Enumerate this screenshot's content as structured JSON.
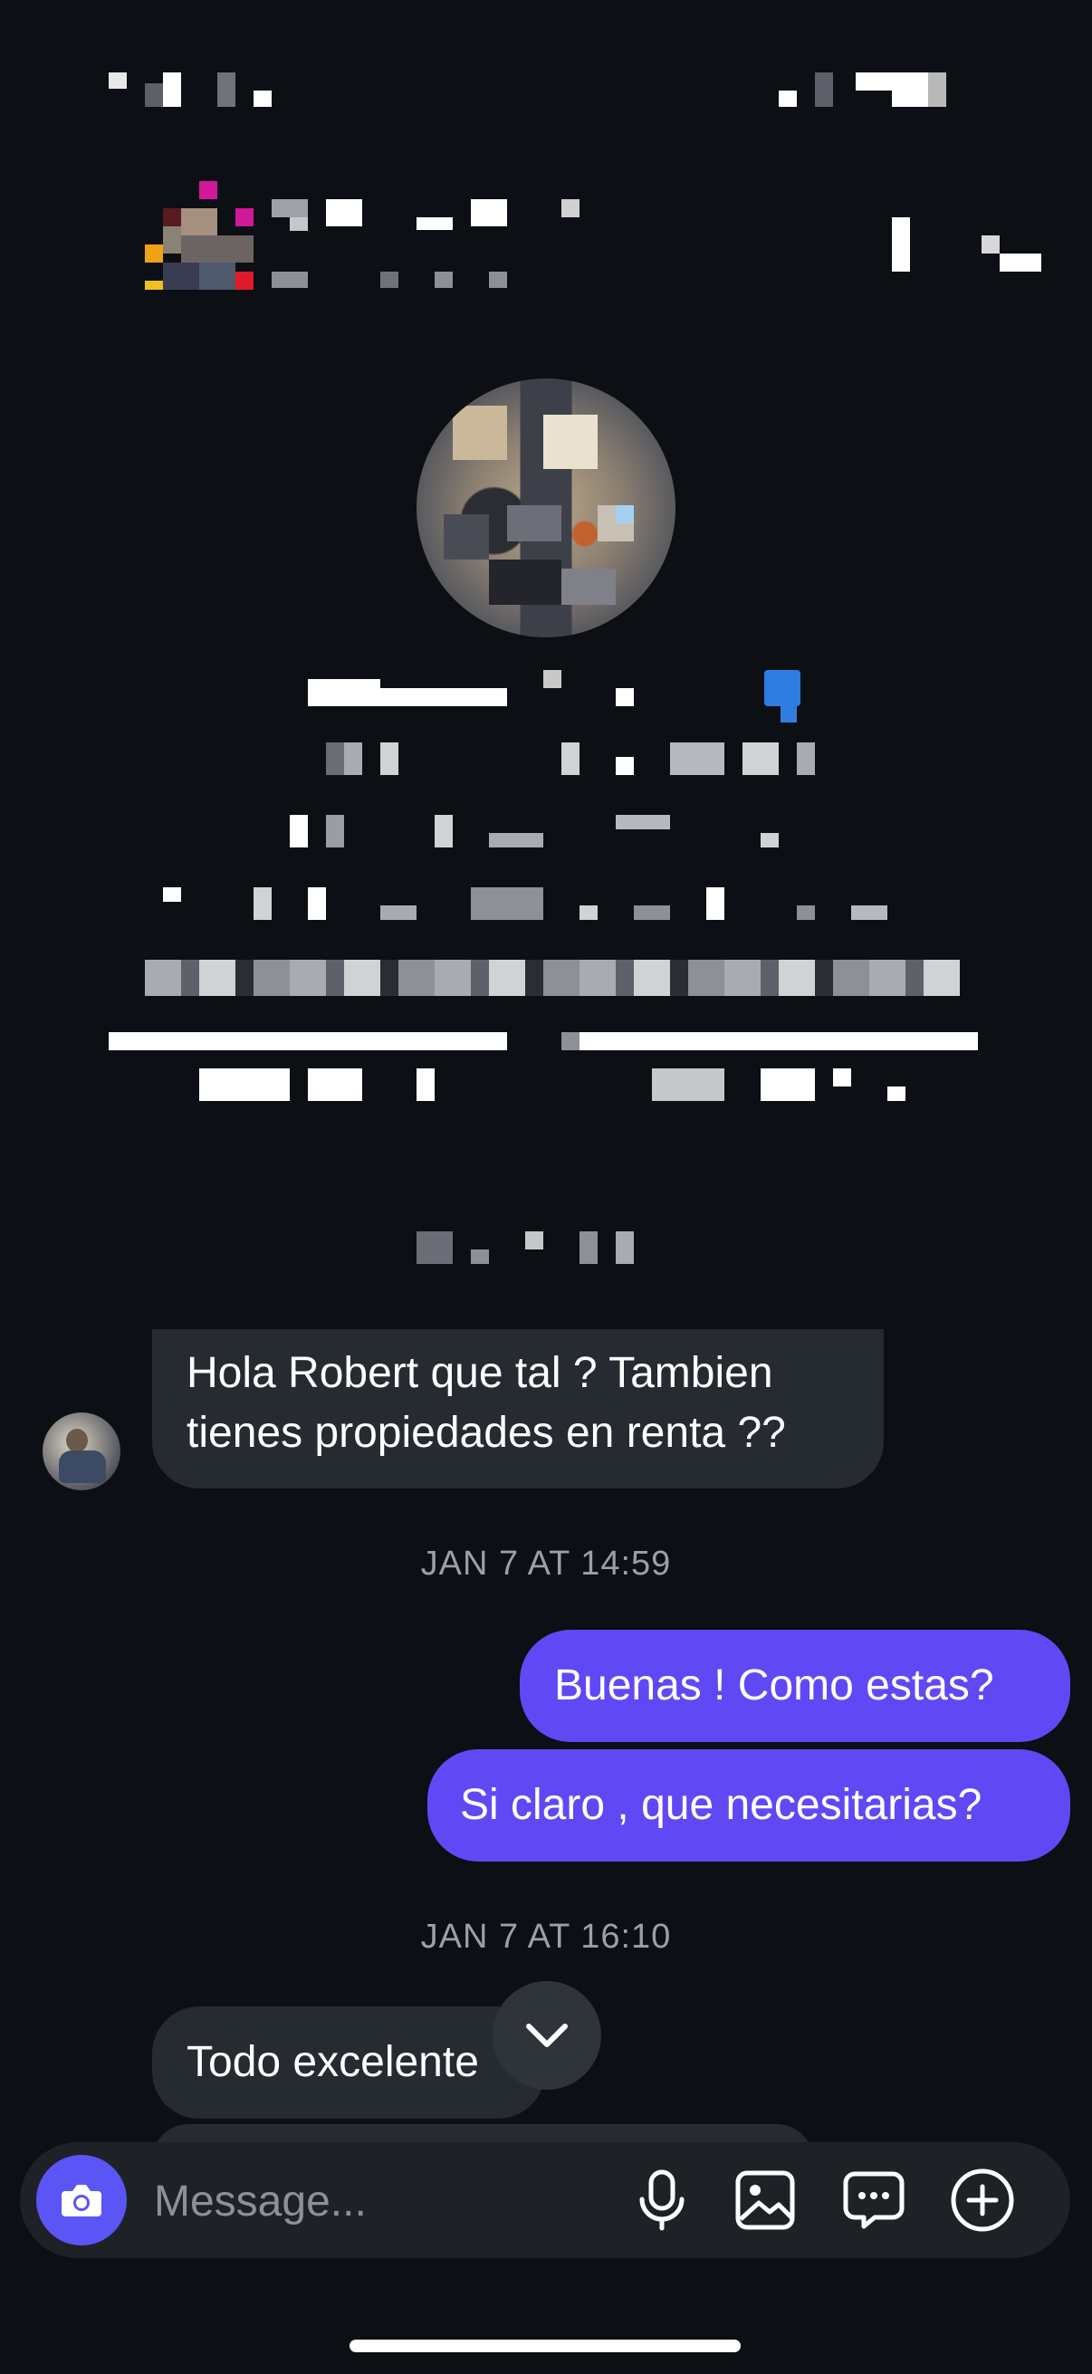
{
  "messages": [
    {
      "direction": "incoming",
      "text_line1": "Hola Robert que tal ? Tambien",
      "text_line2": "tienes propiedades en renta ??"
    },
    {
      "direction": "separator",
      "text": "JAN 7 AT 14:59"
    },
    {
      "direction": "outgoing",
      "text": "Buenas ! Como estas?"
    },
    {
      "direction": "outgoing",
      "text": "Si claro , que necesitarias?"
    },
    {
      "direction": "separator",
      "text": "JAN 7 AT 16:10"
    },
    {
      "direction": "incoming",
      "text": "Todo excelente"
    }
  ],
  "composer": {
    "placeholder": "Message..."
  },
  "icons": {
    "camera": "camera-icon",
    "microphone": "microphone-icon",
    "gallery": "image-icon",
    "chat_menu": "chat-bubble-icon",
    "add": "plus-circle-icon",
    "scroll_down": "chevron-down-icon"
  },
  "colors": {
    "background": "#0c0f14",
    "incoming_bubble": "#262a31",
    "outgoing_bubble": "#6148f5",
    "camera_button": "#5b55f6",
    "timestamp": "#9aa0a8"
  }
}
